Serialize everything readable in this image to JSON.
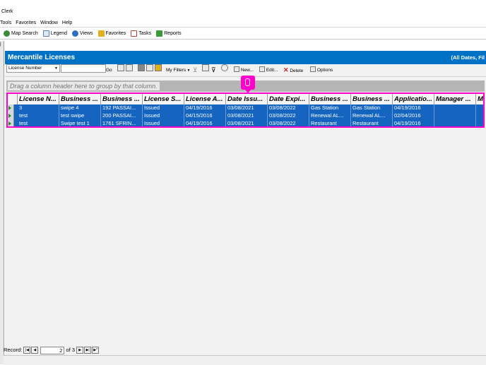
{
  "app": {
    "title": "Clerk"
  },
  "menu": [
    "Tools",
    "Favorites",
    "Window",
    "Help"
  ],
  "nav": [
    {
      "label": "Map Search",
      "icon": "globe-icon",
      "color": "#3a8a3a"
    },
    {
      "label": "Legend",
      "icon": "legend-icon",
      "color": "#5a7ab0"
    },
    {
      "label": "Views",
      "icon": "views-icon",
      "color": "#2e70c0"
    },
    {
      "label": "Favorites",
      "icon": "favorites-icon",
      "color": "#e0b020"
    },
    {
      "label": "Tasks",
      "icon": "tasks-icon",
      "color": "#c04040"
    },
    {
      "label": "Reports",
      "icon": "reports-icon",
      "color": "#3a9a3a"
    }
  ],
  "module": {
    "title": "Mercantile Licenses",
    "filter_text": "(All Dates, Fil"
  },
  "toolbar": {
    "search_field": "License Number",
    "search_value": "",
    "go_label": "Go",
    "my_filters_label": "My Filters",
    "new_label": "New...",
    "edit_label": "Edit...",
    "delete_label": "Delete",
    "options_label": "Options"
  },
  "grid": {
    "group_hint": "Drag a column header here to group by that column.",
    "columns": [
      "License N...",
      "Business ...",
      "Business ...",
      "License S...",
      "License A...",
      "Date Issu...",
      "Date Expi...",
      "Business ...",
      "Business ...",
      "Applicatio...",
      "Manager ...",
      "Ma"
    ],
    "rows": [
      [
        "3",
        "swipe 4",
        "192 PASSAI...",
        "Issued",
        "04/19/2016",
        "03/08/2021",
        "03/08/2022",
        "Gas Station",
        "Gas Station",
        "04/19/2016",
        "",
        ""
      ],
      [
        "test",
        "test swipe",
        "200 PASSAI...",
        "Issued",
        "04/15/2016",
        "03/08/2021",
        "03/08/2022",
        "Renewal AL...",
        "Renewal AL...",
        "02/04/2016",
        "",
        ""
      ],
      [
        "test",
        "Swipe test 1",
        "1761 SFRIN...",
        "Issued",
        "04/19/2016",
        "03/08/2021",
        "03/08/2022",
        "Restaurant",
        "Restaurant",
        "04/19/2016",
        "",
        ""
      ]
    ]
  },
  "status": {
    "record_label": "Record:",
    "current": "2",
    "of_text": "of 3"
  },
  "colors": {
    "accent": "#0072c6",
    "highlight": "#ff00cc",
    "selected_row": "#1565c0"
  }
}
